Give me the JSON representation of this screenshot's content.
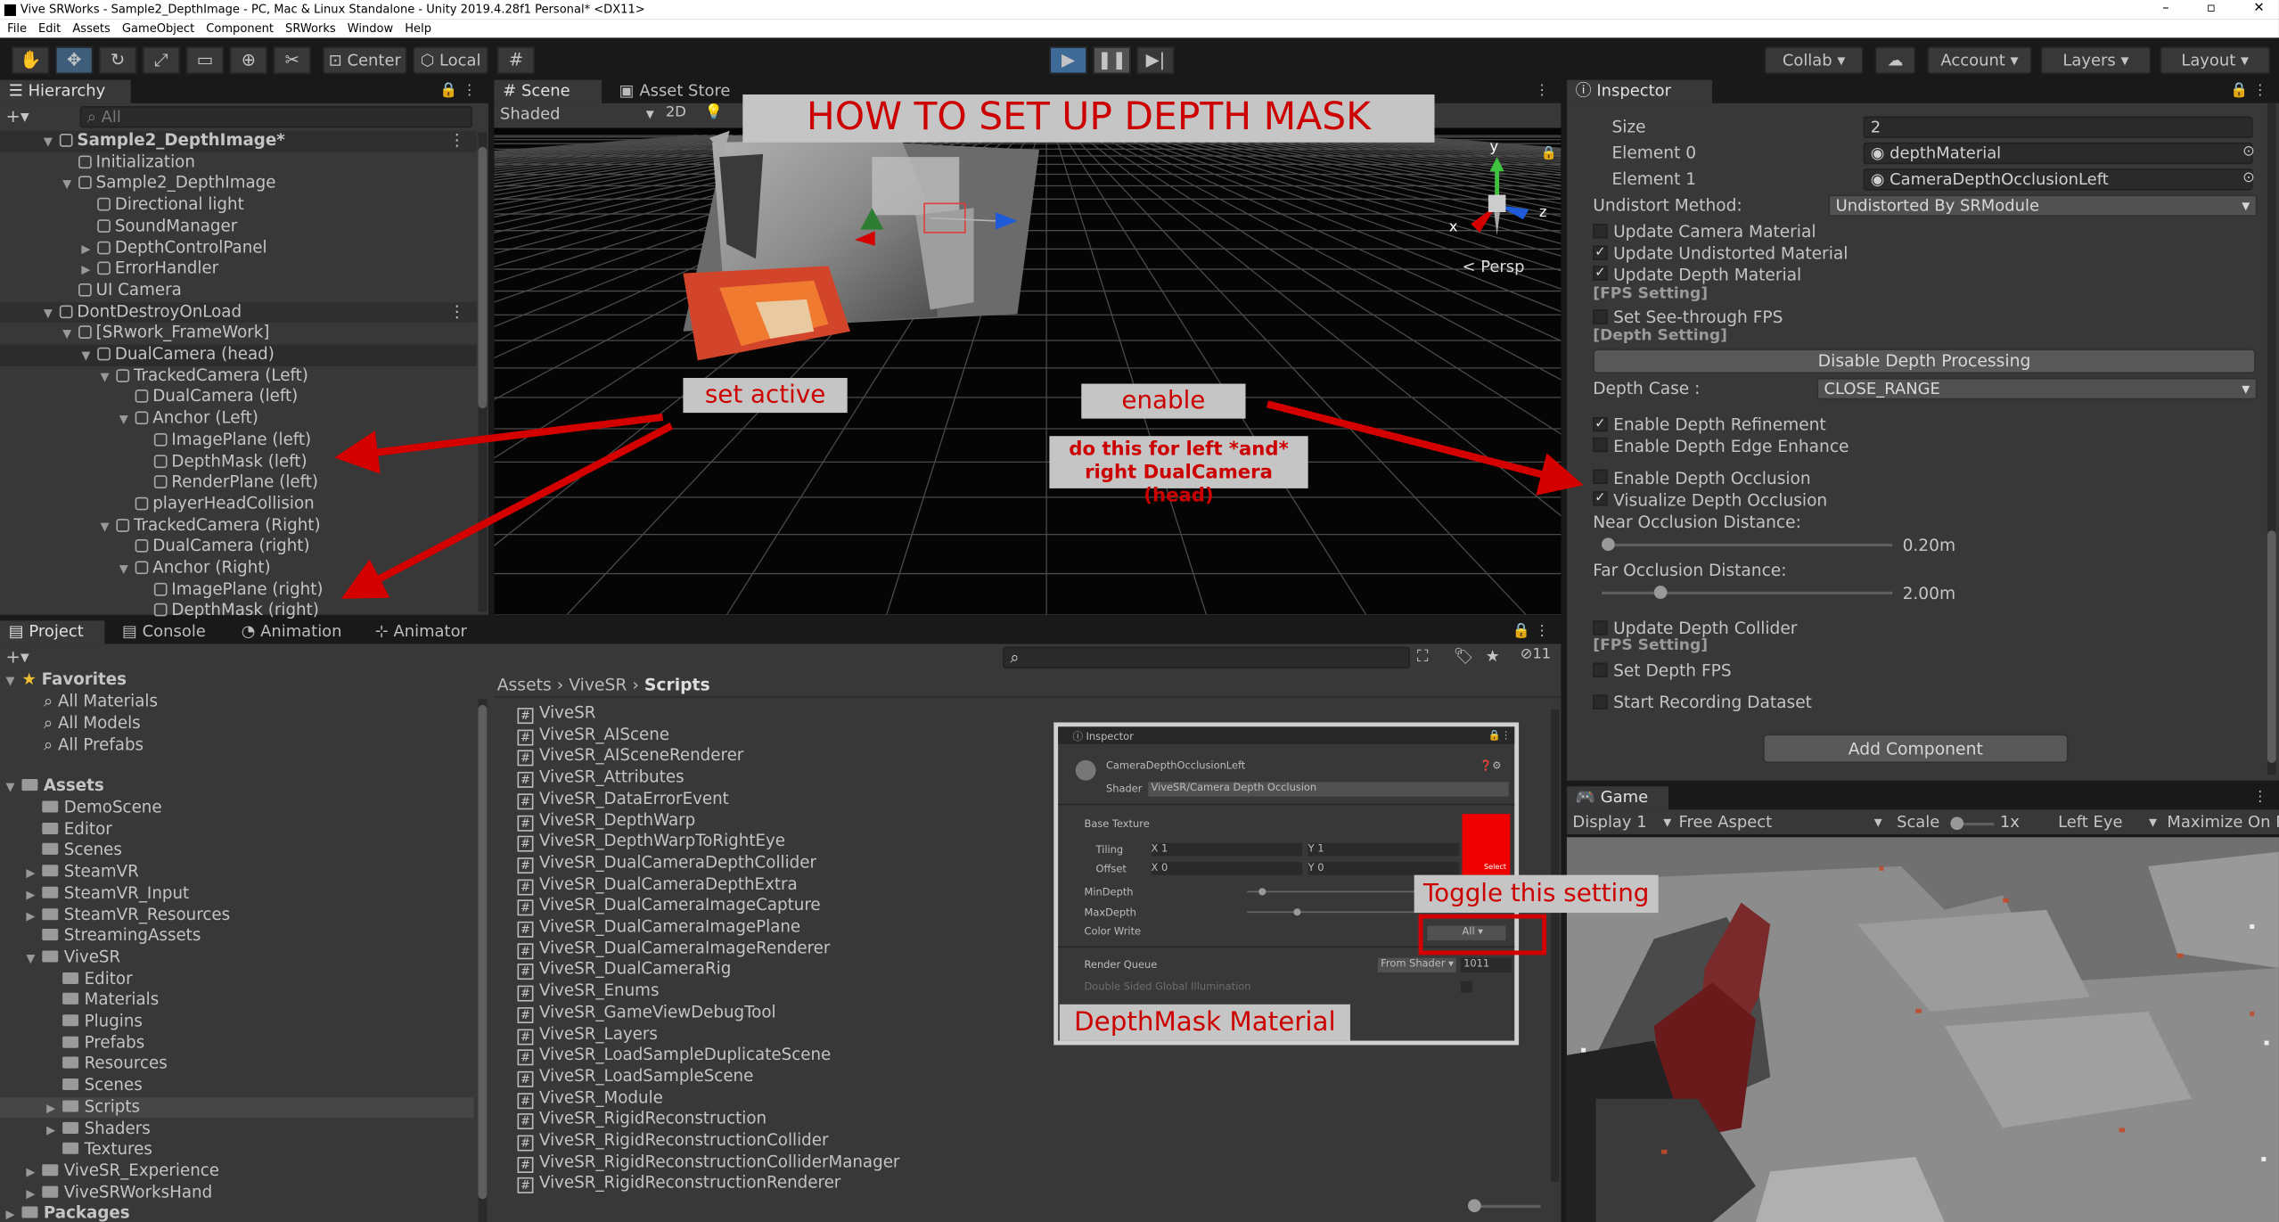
{
  "window": {
    "title": "Vive SRWorks - Sample2_DepthImage - PC, Mac & Linux Standalone - Unity 2019.4.28f1 Personal* <DX11>",
    "min": "–",
    "max": "▫",
    "close": "✕"
  },
  "menu": [
    "File",
    "Edit",
    "Assets",
    "GameObject",
    "Component",
    "SRWorks",
    "Window",
    "Help"
  ],
  "toolbar": {
    "center": "Center",
    "local": "Local",
    "collab": "Collab",
    "account": "Account",
    "layers": "Layers",
    "layout": "Layout"
  },
  "hierarchy": {
    "tab": "Hierarchy",
    "search_placeholder": "All",
    "rows": [
      {
        "label": "Sample2_DepthImage*",
        "indent": 0,
        "fold": "▼",
        "scene": true,
        "bold": true
      },
      {
        "label": "Initialization",
        "indent": 1,
        "fold": ""
      },
      {
        "label": "Sample2_DepthImage",
        "indent": 1,
        "fold": "▼"
      },
      {
        "label": "Directional light",
        "indent": 2,
        "fold": ""
      },
      {
        "label": "SoundManager",
        "indent": 2,
        "fold": ""
      },
      {
        "label": "DepthControlPanel",
        "indent": 2,
        "fold": "▶"
      },
      {
        "label": "ErrorHandler",
        "indent": 2,
        "fold": "▶"
      },
      {
        "label": "UI Camera",
        "indent": 1,
        "fold": ""
      },
      {
        "label": "DontDestroyOnLoad",
        "indent": 0,
        "fold": "▼",
        "scene": true
      },
      {
        "label": "[SRwork_FrameWork]",
        "indent": 1,
        "fold": "▼"
      },
      {
        "label": "DualCamera (head)",
        "indent": 2,
        "fold": "▼",
        "hl": true
      },
      {
        "label": "TrackedCamera (Left)",
        "indent": 3,
        "fold": "▼"
      },
      {
        "label": "DualCamera (left)",
        "indent": 4,
        "fold": ""
      },
      {
        "label": "Anchor (Left)",
        "indent": 4,
        "fold": "▼"
      },
      {
        "label": "ImagePlane (left)",
        "indent": 5,
        "fold": ""
      },
      {
        "label": "DepthMask (left)",
        "indent": 5,
        "fold": ""
      },
      {
        "label": "RenderPlane (left)",
        "indent": 5,
        "fold": ""
      },
      {
        "label": "playerHeadCollision",
        "indent": 4,
        "fold": ""
      },
      {
        "label": "TrackedCamera (Right)",
        "indent": 3,
        "fold": "▼"
      },
      {
        "label": "DualCamera (right)",
        "indent": 4,
        "fold": ""
      },
      {
        "label": "Anchor (Right)",
        "indent": 4,
        "fold": "▼"
      },
      {
        "label": "ImagePlane (right)",
        "indent": 5,
        "fold": ""
      },
      {
        "label": "DepthMask (right)",
        "indent": 5,
        "fold": ""
      }
    ]
  },
  "scene": {
    "tab": "Scene",
    "tab2": "Asset Store",
    "shading": "Shaded",
    "mode2d": "2D",
    "persp": "< Persp",
    "axis_y": "y",
    "axis_x": "x",
    "axis_z": "z"
  },
  "annotations": {
    "title": "HOW TO SET UP DEPTH MASK",
    "set_active": "set active",
    "enable": "enable",
    "note": "do this for left *and* right DualCamera (head)",
    "toggle": "Toggle this setting",
    "material": "DepthMask Material"
  },
  "inspector": {
    "tab": "Inspector",
    "size_label": "Size",
    "size_value": "2",
    "element0_label": "Element 0",
    "element0_value": "depthMaterial",
    "element1_label": "Element 1",
    "element1_value": "CameraDepthOcclusionLeft",
    "undistort_label": "Undistort Method:",
    "undistort_value": "Undistorted By SRModule",
    "cb_update_camera": "Update Camera Material",
    "cb_update_undistorted": "Update Undistorted Material",
    "cb_update_depth": "Update Depth Material",
    "fps_header": "[FPS Setting]",
    "cb_seethrough_fps": "Set See-through FPS",
    "depth_header": "[Depth Setting]",
    "disable_depth_btn": "Disable Depth Processing",
    "depth_case_label": "Depth Case        :",
    "depth_case_value": "CLOSE_RANGE",
    "cb_refinement": "Enable Depth Refinement",
    "cb_edge": "Enable Depth Edge Enhance",
    "cb_occlusion": "Enable Depth Occlusion",
    "cb_visualize": "Visualize Depth Occlusion",
    "near_label": "Near Occlusion Distance:",
    "near_value": "0.20m",
    "near_fraction": 0.02,
    "far_label": "Far Occlusion Distance:",
    "far_value": "2.00m",
    "far_fraction": 0.2,
    "cb_collider": "Update Depth Collider",
    "fps_header2": "[FPS Setting]",
    "cb_depth_fps": "Set Depth FPS",
    "cb_recording": "Start Recording Dataset",
    "add_component": "Add Component",
    "checked": {
      "update_undistorted": true,
      "update_depth": true,
      "refinement": true,
      "visualize": true
    }
  },
  "project": {
    "tab": "Project",
    "console": "Console",
    "animation": "Animation",
    "animator": "Animator",
    "hidden_count": "11",
    "favorites": {
      "label": "Favorites",
      "items": [
        "All Materials",
        "All Models",
        "All Prefabs"
      ]
    },
    "assets_label": "Assets",
    "tree": [
      {
        "label": "DemoScene",
        "indent": 1,
        "fold": ""
      },
      {
        "label": "Editor",
        "indent": 1,
        "fold": ""
      },
      {
        "label": "Scenes",
        "indent": 1,
        "fold": ""
      },
      {
        "label": "SteamVR",
        "indent": 1,
        "fold": "▶"
      },
      {
        "label": "SteamVR_Input",
        "indent": 1,
        "fold": "▶"
      },
      {
        "label": "SteamVR_Resources",
        "indent": 1,
        "fold": "▶"
      },
      {
        "label": "StreamingAssets",
        "indent": 1,
        "fold": ""
      },
      {
        "label": "ViveSR",
        "indent": 1,
        "fold": "▼"
      },
      {
        "label": "Editor",
        "indent": 2,
        "fold": ""
      },
      {
        "label": "Materials",
        "indent": 2,
        "fold": ""
      },
      {
        "label": "Plugins",
        "indent": 2,
        "fold": ""
      },
      {
        "label": "Prefabs",
        "indent": 2,
        "fold": ""
      },
      {
        "label": "Resources",
        "indent": 2,
        "fold": ""
      },
      {
        "label": "Scenes",
        "indent": 2,
        "fold": ""
      },
      {
        "label": "Scripts",
        "indent": 2,
        "fold": "▶",
        "hl": true
      },
      {
        "label": "Shaders",
        "indent": 2,
        "fold": "▶"
      },
      {
        "label": "Textures",
        "indent": 2,
        "fold": ""
      },
      {
        "label": "ViveSR_Experience",
        "indent": 1,
        "fold": "▶"
      },
      {
        "label": "ViveSRWorksHand",
        "indent": 1,
        "fold": "▶"
      },
      {
        "label": "Packages",
        "indent": 0,
        "fold": "▶"
      }
    ],
    "breadcrumb": [
      "Assets",
      "ViveSR",
      "Scripts"
    ],
    "files": [
      "ViveSR",
      "ViveSR_AIScene",
      "ViveSR_AISceneRenderer",
      "ViveSR_Attributes",
      "ViveSR_DataErrorEvent",
      "ViveSR_DepthWarp",
      "ViveSR_DepthWarpToRightEye",
      "ViveSR_DualCameraDepthCollider",
      "ViveSR_DualCameraDepthExtra",
      "ViveSR_DualCameraImageCapture",
      "ViveSR_DualCameraImagePlane",
      "ViveSR_DualCameraImageRenderer",
      "ViveSR_DualCameraRig",
      "ViveSR_Enums",
      "ViveSR_GameViewDebugTool",
      "ViveSR_Layers",
      "ViveSR_LoadSampleDuplicateScene",
      "ViveSR_LoadSampleScene",
      "ViveSR_Module",
      "ViveSR_RigidReconstruction",
      "ViveSR_RigidReconstructionCollider",
      "ViveSR_RigidReconstructionColliderManager",
      "ViveSR_RigidReconstructionRenderer"
    ]
  },
  "inset": {
    "tab": "Inspector",
    "name": "CameraDepthOcclusionLeft",
    "shader_label": "Shader",
    "shader_value": "ViveSR/Camera Depth Occlusion",
    "base_texture": "Base Texture",
    "tiling": "Tiling",
    "offset": "Offset",
    "x1": "X 1",
    "y1": "Y 1",
    "x0": "X 0",
    "y0": "Y 0",
    "min_depth": "MinDepth",
    "max_depth": "MaxDepth",
    "color_write": "Color Write",
    "color_write_value": "All",
    "render_queue": "Render Queue",
    "from_shader": "From Shader",
    "queue_value": "1011",
    "double_sided": "Double Sided Global Illumination",
    "select": "Select"
  },
  "game": {
    "tab": "Game",
    "display": "Display 1",
    "aspect": "Free Aspect",
    "scale_label": "Scale",
    "scale_value": "1x",
    "eye": "Left Eye",
    "maximize": "Maximize On P"
  },
  "colors": {
    "accent_red": "#d40000",
    "label_bg": "#c5c5c5",
    "panel": "#383838",
    "dark": "#191919"
  }
}
